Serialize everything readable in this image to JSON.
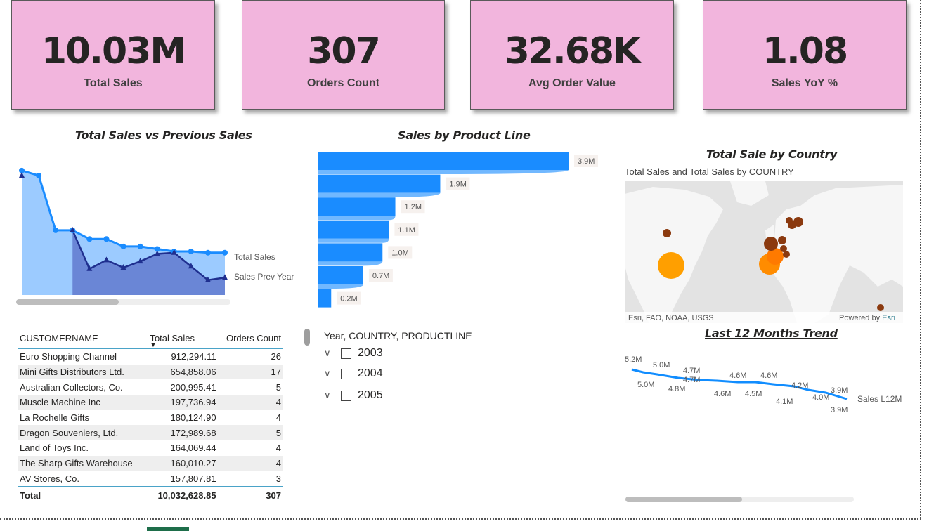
{
  "kpis": [
    {
      "value": "10.03M",
      "label": "Total Sales"
    },
    {
      "value": "307",
      "label": "Orders Count"
    },
    {
      "value": "32.68K",
      "label": "Avg Order Value"
    },
    {
      "value": "1.08",
      "label": "Sales YoY %"
    }
  ],
  "line_chart": {
    "title": "Total Sales vs Previous Sales",
    "legend": [
      "Total Sales",
      "Sales Prev Year"
    ],
    "scrollbar_position": 0.0
  },
  "bar_chart": {
    "title": "Sales by Product Line",
    "data_labels": [
      "3.9M",
      "1.9M",
      "1.2M",
      "1.1M",
      "1.0M",
      "0.7M",
      "0.2M"
    ]
  },
  "map": {
    "title": "Total Sale by Country",
    "subtitle": "Total Sales and Total Sales by COUNTRY",
    "attribution": "Esri, FAO, NOAA, USGS",
    "powered_by": "Powered by",
    "powered_by_brand": "Esri"
  },
  "trend": {
    "title": "Last 12 Months Trend",
    "series_label": "Sales L12M",
    "labels": [
      "5.2M",
      "5.0M",
      "5.0M",
      "4.8M",
      "4.7M",
      "4.7M",
      "4.6M",
      "4.6M",
      "4.6M",
      "4.5M",
      "4.2M",
      "4.1M",
      "4.0M",
      "3.9M",
      "3.9M"
    ]
  },
  "table": {
    "headers": [
      "CUSTOMERNAME",
      "Total Sales",
      "Orders Count"
    ],
    "rows": [
      [
        "Euro Shopping Channel",
        "912,294.11",
        "26"
      ],
      [
        "Mini Gifts Distributors Ltd.",
        "654,858.06",
        "17"
      ],
      [
        "Australian Collectors, Co.",
        "200,995.41",
        "5"
      ],
      [
        "Muscle Machine Inc",
        "197,736.94",
        "4"
      ],
      [
        "La Rochelle Gifts",
        "180,124.90",
        "4"
      ],
      [
        "Dragon Souveniers, Ltd.",
        "172,989.68",
        "5"
      ],
      [
        "Land of Toys Inc.",
        "164,069.44",
        "4"
      ],
      [
        "The Sharp Gifts Warehouse",
        "160,010.27",
        "4"
      ],
      [
        "AV Stores, Co.",
        "157,807.81",
        "3"
      ]
    ],
    "total": [
      "Total",
      "10,032,628.85",
      "307"
    ]
  },
  "slicer": {
    "header": "Year, COUNTRY, PRODUCTLINE",
    "items": [
      "2003",
      "2004",
      "2005"
    ]
  },
  "chart_data": [
    {
      "type": "area",
      "title": "Total Sales vs Previous Sales",
      "series": [
        {
          "name": "Total Sales",
          "values": [
            10.0,
            9.6,
            5.2,
            5.2,
            4.5,
            4.5,
            3.9,
            3.9,
            3.7,
            3.5,
            3.5,
            3.4,
            3.4
          ]
        },
        {
          "name": "Sales Prev Year",
          "values": [
            9.6,
            null,
            null,
            5.2,
            2.1,
            2.8,
            2.2,
            2.7,
            3.3,
            3.4,
            2.3,
            1.2,
            1.4
          ]
        }
      ]
    },
    {
      "type": "bar",
      "title": "Sales by Product Line",
      "values": [
        3.9,
        1.9,
        1.2,
        1.1,
        1.0,
        0.7,
        0.2
      ],
      "unit": "M"
    },
    {
      "type": "line",
      "title": "Last 12 Months Trend",
      "series": [
        {
          "name": "Sales L12M",
          "values": [
            5.2,
            5.0,
            4.8,
            4.7,
            4.7,
            4.6,
            4.6,
            4.5,
            4.2,
            4.1,
            4.0,
            3.9,
            3.9
          ]
        }
      ]
    }
  ]
}
